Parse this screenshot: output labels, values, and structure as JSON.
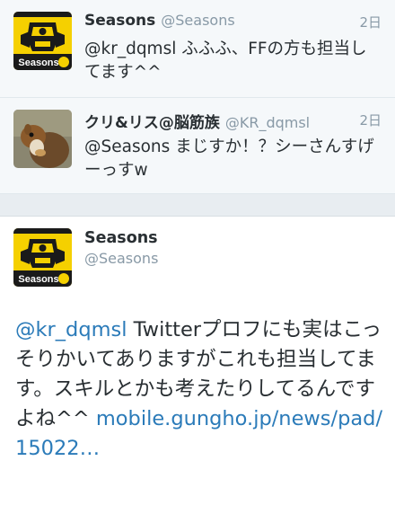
{
  "tweets": [
    {
      "name": "Seasons",
      "handle": "@Seasons",
      "time": "2日",
      "mention": "@kr_dqmsl",
      "text": " ふふふ、FFの方も担当してます^^",
      "avatar_label": "Seasons"
    },
    {
      "name": "クリ&リス@脳筋族",
      "handle": "@KR_dqmsl",
      "time": "2日",
      "mention": "@Seasons",
      "text": " まじすか！？シーさんすげーっすw"
    }
  ],
  "main_tweet": {
    "name": "Seasons",
    "handle": "@Seasons",
    "avatar_label": "Seasons",
    "mention": "@kr_dqmsl",
    "text": " Twitterプロフにも実はこっそりかいてありますがこれも担当してます。スキルとかも考えたりしてるんですよね^^ ",
    "link": "mobile.gungho.jp/news/pad/15022…"
  },
  "colors": {
    "link": "#2b7bb9",
    "muted": "#8899a6",
    "text": "#292f33",
    "avatar_yellow": "#f5d000"
  },
  "icons": {
    "seasons_avatar": "yellow-black-helmet-emblem",
    "squirrel_avatar": "squirrel-photo"
  }
}
